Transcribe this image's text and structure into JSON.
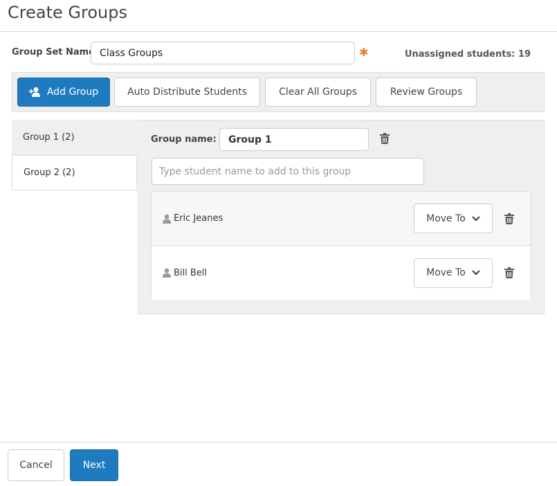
{
  "header": {
    "title": "Create Groups"
  },
  "group_set": {
    "label": "Group Set Name:",
    "value": "Class Groups",
    "required_marker": "✱",
    "unassigned_text": "Unassigned students: 19"
  },
  "toolbar": {
    "add_group": "Add Group",
    "auto_distribute": "Auto Distribute Students",
    "clear_all": "Clear All Groups",
    "review": "Review Groups"
  },
  "tabs": [
    {
      "label": "Group 1 (2)",
      "active": true
    },
    {
      "label": "Group 2 (2)",
      "active": false
    }
  ],
  "group_detail": {
    "name_label": "Group name:",
    "name_value": "Group 1",
    "search_placeholder": "Type student name to add to this group",
    "students": [
      {
        "name": "Eric Jeanes",
        "move_label": "Move To"
      },
      {
        "name": "Bill Bell",
        "move_label": "Move To"
      }
    ]
  },
  "footer": {
    "cancel": "Cancel",
    "next": "Next"
  },
  "colors": {
    "primary": "#1f7bc0",
    "required": "#e87d2d",
    "panel_bg": "#efefef"
  },
  "icons": {
    "add_group": "add-users-icon",
    "trash": "trash-icon",
    "person": "person-icon",
    "chevron": "chevron-down-icon"
  }
}
